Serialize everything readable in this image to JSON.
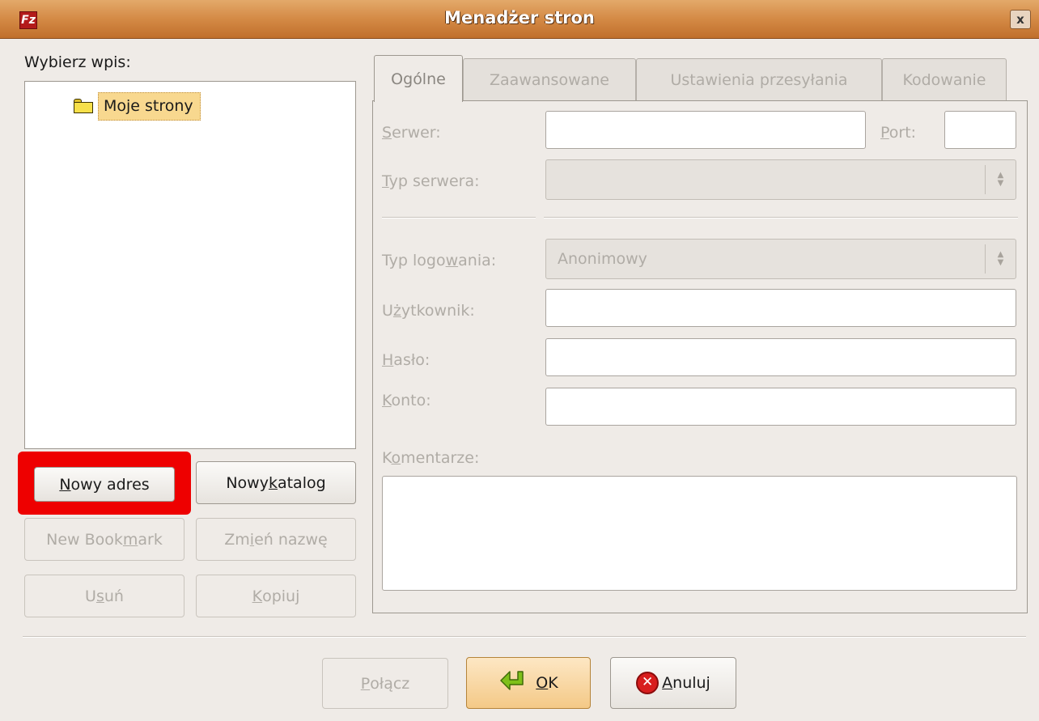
{
  "window": {
    "title": "Menadżer stron",
    "close": "x",
    "app_icon": "Fz"
  },
  "left": {
    "select_label": "Wybierz wpis:",
    "tree_item": "Moje strony",
    "buttons": {
      "new_site_pre": "",
      "new_site_u": "N",
      "new_site_post": "owy adres",
      "new_folder_pre": "Nowy ",
      "new_folder_u": "k",
      "new_folder_post": "atalog",
      "new_bookmark_pre": "New Book",
      "new_bookmark_u": "m",
      "new_bookmark_post": "ark",
      "rename_pre": "Zm",
      "rename_u": "i",
      "rename_post": "eń nazwę",
      "delete_pre": "U",
      "delete_u": "s",
      "delete_post": "uń",
      "copy_pre": "",
      "copy_u": "K",
      "copy_post": "opiuj"
    }
  },
  "tabs": [
    "Ogólne",
    "Zaawansowane",
    "Ustawienia przesyłania",
    "Kodowanie"
  ],
  "general": {
    "server_u": "S",
    "server_rest": "erwer:",
    "port_u": "P",
    "port_rest": "ort:",
    "server_type_u": "T",
    "server_type_rest": "yp serwera:",
    "server_type_value": "",
    "logon_type_pre": "Typ logo",
    "logon_type_u": "w",
    "logon_type_post": "ania:",
    "logon_type_value": "Anonimowy",
    "user_pre": "U",
    "user_u": "ż",
    "user_post": "ytkownik:",
    "password_u": "H",
    "password_rest": "asło:",
    "account_u": "K",
    "account_rest": "onto:",
    "comments_pre": "K",
    "comments_u": "o",
    "comments_post": "mentarze:",
    "server_value": "",
    "port_value": "",
    "user_value": "",
    "password_value": "",
    "account_value": "",
    "comments_value": ""
  },
  "footer": {
    "connect_pre": "",
    "connect_u": "P",
    "connect_post": "ołącz",
    "ok_u": "O",
    "ok_rest": "K",
    "cancel_u": "A",
    "cancel_rest": "nuluj"
  },
  "colors": {
    "highlight": "#ee0000",
    "titlebar": "#d48a45",
    "selection": "#f8d88f"
  },
  "icons": [
    "fz-app-icon",
    "close-icon",
    "folder-icon",
    "ok-arrow-icon",
    "cancel-icon"
  ]
}
